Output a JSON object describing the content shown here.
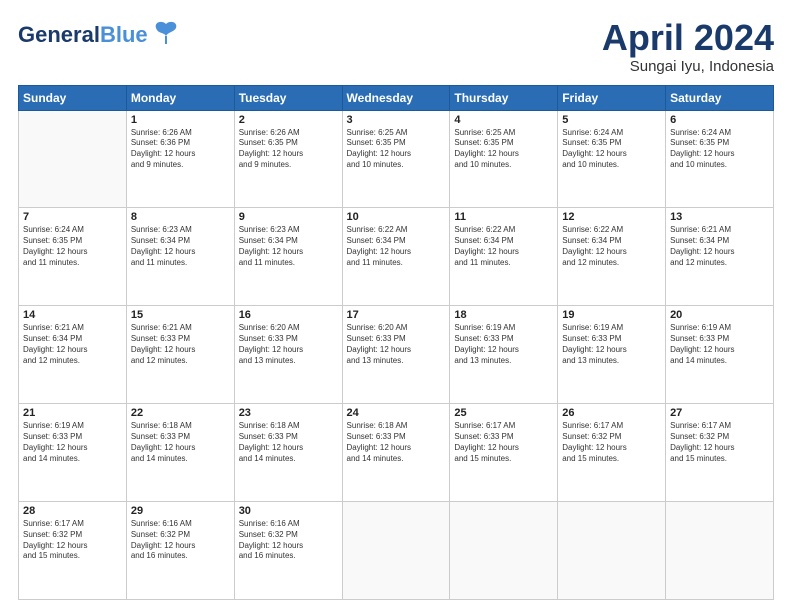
{
  "header": {
    "logo_line1": "General",
    "logo_line2": "Blue",
    "title": "April 2024",
    "subtitle": "Sungai Iyu, Indonesia"
  },
  "days_of_week": [
    "Sunday",
    "Monday",
    "Tuesday",
    "Wednesday",
    "Thursday",
    "Friday",
    "Saturday"
  ],
  "weeks": [
    [
      {
        "num": "",
        "info": ""
      },
      {
        "num": "1",
        "info": "Sunrise: 6:26 AM\nSunset: 6:36 PM\nDaylight: 12 hours\nand 9 minutes."
      },
      {
        "num": "2",
        "info": "Sunrise: 6:26 AM\nSunset: 6:35 PM\nDaylight: 12 hours\nand 9 minutes."
      },
      {
        "num": "3",
        "info": "Sunrise: 6:25 AM\nSunset: 6:35 PM\nDaylight: 12 hours\nand 10 minutes."
      },
      {
        "num": "4",
        "info": "Sunrise: 6:25 AM\nSunset: 6:35 PM\nDaylight: 12 hours\nand 10 minutes."
      },
      {
        "num": "5",
        "info": "Sunrise: 6:24 AM\nSunset: 6:35 PM\nDaylight: 12 hours\nand 10 minutes."
      },
      {
        "num": "6",
        "info": "Sunrise: 6:24 AM\nSunset: 6:35 PM\nDaylight: 12 hours\nand 10 minutes."
      }
    ],
    [
      {
        "num": "7",
        "info": "Sunrise: 6:24 AM\nSunset: 6:35 PM\nDaylight: 12 hours\nand 11 minutes."
      },
      {
        "num": "8",
        "info": "Sunrise: 6:23 AM\nSunset: 6:34 PM\nDaylight: 12 hours\nand 11 minutes."
      },
      {
        "num": "9",
        "info": "Sunrise: 6:23 AM\nSunset: 6:34 PM\nDaylight: 12 hours\nand 11 minutes."
      },
      {
        "num": "10",
        "info": "Sunrise: 6:22 AM\nSunset: 6:34 PM\nDaylight: 12 hours\nand 11 minutes."
      },
      {
        "num": "11",
        "info": "Sunrise: 6:22 AM\nSunset: 6:34 PM\nDaylight: 12 hours\nand 11 minutes."
      },
      {
        "num": "12",
        "info": "Sunrise: 6:22 AM\nSunset: 6:34 PM\nDaylight: 12 hours\nand 12 minutes."
      },
      {
        "num": "13",
        "info": "Sunrise: 6:21 AM\nSunset: 6:34 PM\nDaylight: 12 hours\nand 12 minutes."
      }
    ],
    [
      {
        "num": "14",
        "info": "Sunrise: 6:21 AM\nSunset: 6:34 PM\nDaylight: 12 hours\nand 12 minutes."
      },
      {
        "num": "15",
        "info": "Sunrise: 6:21 AM\nSunset: 6:33 PM\nDaylight: 12 hours\nand 12 minutes."
      },
      {
        "num": "16",
        "info": "Sunrise: 6:20 AM\nSunset: 6:33 PM\nDaylight: 12 hours\nand 13 minutes."
      },
      {
        "num": "17",
        "info": "Sunrise: 6:20 AM\nSunset: 6:33 PM\nDaylight: 12 hours\nand 13 minutes."
      },
      {
        "num": "18",
        "info": "Sunrise: 6:19 AM\nSunset: 6:33 PM\nDaylight: 12 hours\nand 13 minutes."
      },
      {
        "num": "19",
        "info": "Sunrise: 6:19 AM\nSunset: 6:33 PM\nDaylight: 12 hours\nand 13 minutes."
      },
      {
        "num": "20",
        "info": "Sunrise: 6:19 AM\nSunset: 6:33 PM\nDaylight: 12 hours\nand 14 minutes."
      }
    ],
    [
      {
        "num": "21",
        "info": "Sunrise: 6:19 AM\nSunset: 6:33 PM\nDaylight: 12 hours\nand 14 minutes."
      },
      {
        "num": "22",
        "info": "Sunrise: 6:18 AM\nSunset: 6:33 PM\nDaylight: 12 hours\nand 14 minutes."
      },
      {
        "num": "23",
        "info": "Sunrise: 6:18 AM\nSunset: 6:33 PM\nDaylight: 12 hours\nand 14 minutes."
      },
      {
        "num": "24",
        "info": "Sunrise: 6:18 AM\nSunset: 6:33 PM\nDaylight: 12 hours\nand 14 minutes."
      },
      {
        "num": "25",
        "info": "Sunrise: 6:17 AM\nSunset: 6:33 PM\nDaylight: 12 hours\nand 15 minutes."
      },
      {
        "num": "26",
        "info": "Sunrise: 6:17 AM\nSunset: 6:32 PM\nDaylight: 12 hours\nand 15 minutes."
      },
      {
        "num": "27",
        "info": "Sunrise: 6:17 AM\nSunset: 6:32 PM\nDaylight: 12 hours\nand 15 minutes."
      }
    ],
    [
      {
        "num": "28",
        "info": "Sunrise: 6:17 AM\nSunset: 6:32 PM\nDaylight: 12 hours\nand 15 minutes."
      },
      {
        "num": "29",
        "info": "Sunrise: 6:16 AM\nSunset: 6:32 PM\nDaylight: 12 hours\nand 16 minutes."
      },
      {
        "num": "30",
        "info": "Sunrise: 6:16 AM\nSunset: 6:32 PM\nDaylight: 12 hours\nand 16 minutes."
      },
      {
        "num": "",
        "info": ""
      },
      {
        "num": "",
        "info": ""
      },
      {
        "num": "",
        "info": ""
      },
      {
        "num": "",
        "info": ""
      }
    ]
  ]
}
